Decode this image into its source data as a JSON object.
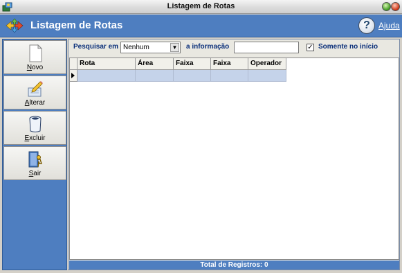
{
  "window": {
    "title": "Listagem de Rotas"
  },
  "header": {
    "title": "Listagem de Rotas",
    "help_label": "Ajuda"
  },
  "sidebar": {
    "items": [
      {
        "label": "Novo",
        "icon": "new-document-icon"
      },
      {
        "label": "Alterar",
        "icon": "edit-pencil-icon"
      },
      {
        "label": "Excluir",
        "icon": "trash-bin-icon"
      },
      {
        "label": "Sair",
        "icon": "exit-door-icon"
      }
    ]
  },
  "search": {
    "label": "Pesquisar em",
    "selected": "Nenhum",
    "info_label": "a informação",
    "info_value": "",
    "start_only_label": "Somente no início",
    "start_only_checked": true
  },
  "grid": {
    "columns": [
      "Rota",
      "Área",
      "Faixa",
      "Faixa",
      "Operador"
    ]
  },
  "footer": {
    "total_text": "Total de Registros: 0"
  },
  "colors": {
    "accent": "#4e7ec0",
    "selected_row": "#c5d3ea",
    "label_blue": "#0a2f7a"
  }
}
